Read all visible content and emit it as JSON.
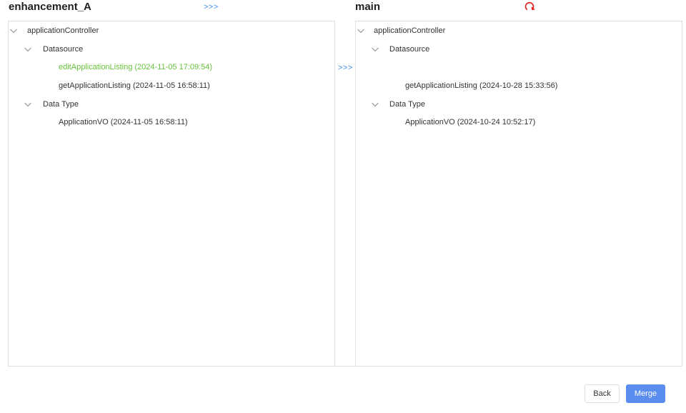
{
  "left": {
    "branch": "enhancement_A",
    "tree": {
      "controller": "applicationController",
      "datasource_label": "Datasource",
      "datasource_items": [
        {
          "label": "editApplicationListing (2024-11-05 17:09:54)",
          "status": "added"
        },
        {
          "label": "getApplicationListing (2024-11-05 16:58:11)",
          "status": "modified"
        }
      ],
      "datatype_label": "Data Type",
      "datatype_items": [
        {
          "label": "ApplicationVO (2024-11-05 16:58:11)",
          "status": "modified"
        }
      ]
    }
  },
  "right": {
    "branch": "main",
    "tree": {
      "controller": "applicationController",
      "datasource_label": "Datasource",
      "datasource_items": [
        {
          "label": "getApplicationListing (2024-10-28 15:33:56)"
        }
      ],
      "datatype_label": "Data Type",
      "datatype_items": [
        {
          "label": "ApplicationVO (2024-10-24 10:52:17)"
        }
      ]
    }
  },
  "copy_arrows_top": ">>>",
  "copy_arrows_mid": ">>>",
  "buttons": {
    "back": "Back",
    "merge": "Merge"
  },
  "icons": {
    "refresh": "refresh-icon",
    "expand": "chevron-down-icon"
  },
  "colors": {
    "link": "#3a8ee6",
    "added": "#67c23a",
    "refresh": "#e02020",
    "primary": "#5b8def"
  }
}
